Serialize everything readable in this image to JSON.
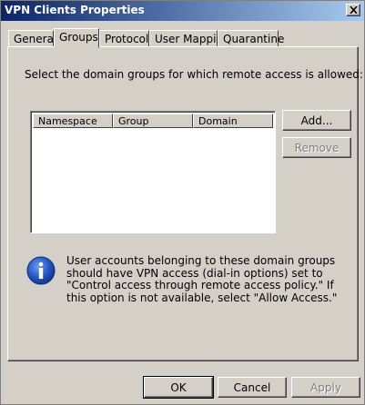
{
  "window": {
    "title": "VPN Clients Properties",
    "close_glyph": "✕"
  },
  "tabs": [
    {
      "label": "General",
      "active": false
    },
    {
      "label": "Groups",
      "active": true
    },
    {
      "label": "Protocols",
      "active": false
    },
    {
      "label": "User Mapping",
      "active": false
    },
    {
      "label": "Quarantine",
      "active": false
    }
  ],
  "groups_page": {
    "instruction": "Select the domain groups for which remote access is allowed:",
    "list": {
      "columns": [
        "Namespace",
        "Group",
        "Domain"
      ],
      "rows": []
    },
    "add_button": "Add...",
    "remove_button": "Remove",
    "info_icon": "info-icon",
    "info_text": "User accounts belonging to these domain groups should have VPN access (dial-in options) set to \"Control access through remote access policy.\" If this option is not available, select \"Allow Access.\""
  },
  "footer": {
    "ok_button": "OK",
    "cancel_button": "Cancel",
    "apply_button": "Apply"
  },
  "colors": {
    "face": "#d4d0c8",
    "title_start": "#0a246a",
    "title_end": "#a6caf0",
    "info_blue": "#1c4fb8"
  }
}
